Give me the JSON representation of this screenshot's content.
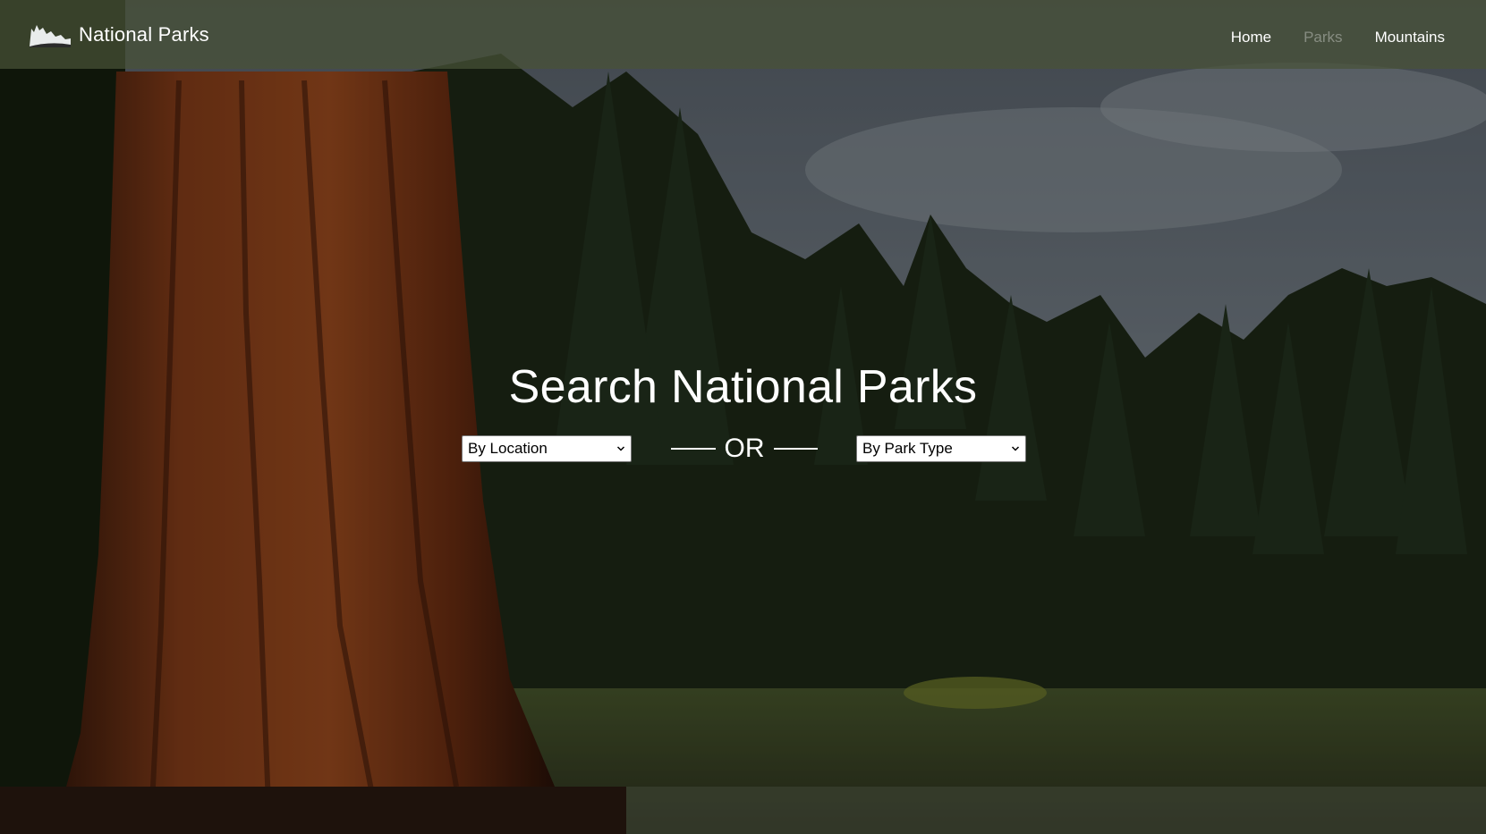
{
  "navbar": {
    "brand": "National Parks",
    "links": [
      {
        "label": "Home",
        "active": false,
        "disabled": false
      },
      {
        "label": "Parks",
        "active": false,
        "disabled": true
      },
      {
        "label": "Mountains",
        "active": false,
        "disabled": false
      }
    ]
  },
  "hero": {
    "title": "Search National Parks",
    "location_select": {
      "value": "By Location"
    },
    "divider": "OR",
    "type_select": {
      "value": "By Park Type"
    }
  },
  "icons": {
    "brand_logo": "mountain-silhouette-icon",
    "select_arrow": "chevron-down-icon"
  },
  "colors": {
    "navbar_bg": "#485237",
    "text": "#ffffff",
    "nav_disabled": "#8a8f7f"
  }
}
